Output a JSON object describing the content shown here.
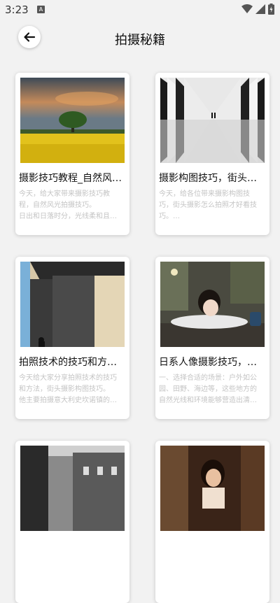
{
  "status": {
    "time": "3:23",
    "notif_letter": "A"
  },
  "header": {
    "title": "拍摄秘籍"
  },
  "articles": [
    {
      "title": "摄影技巧教程_自然风…",
      "desc": [
        "今天，给大家带来摄影技巧教",
        "程，自然风光拍摄技巧。",
        "日出和日落时分，光线柔和且…"
      ],
      "image": "landscape-yellow-field-tree"
    },
    {
      "title": "摄影构图技巧，街头…",
      "desc": [
        "今天，给各位带来摄影构图技",
        "巧，街头摄影怎么拍照才好看技",
        "巧。…"
      ],
      "image": "tunnel-reflection-bw"
    },
    {
      "title": "拍照技术的技巧和方…",
      "desc": [
        "今天给大家分享拍照技术的技巧",
        "和方法，街头摄影构图技巧。",
        "他主要拍摄意大利史坎诺镇的…"
      ],
      "image": "building-shadow-person"
    },
    {
      "title": "日系人像摄影技巧，…",
      "desc": [
        "一、选择合适的场景：户外如公",
        "园、田野、海边等，这些地方的",
        "自然光线和环境能够营造出清…"
      ],
      "image": "girl-resting-on-table"
    },
    {
      "title": "",
      "desc": [],
      "image": "old-city-street-bw"
    },
    {
      "title": "",
      "desc": [],
      "image": "woman-portrait-warm"
    }
  ]
}
